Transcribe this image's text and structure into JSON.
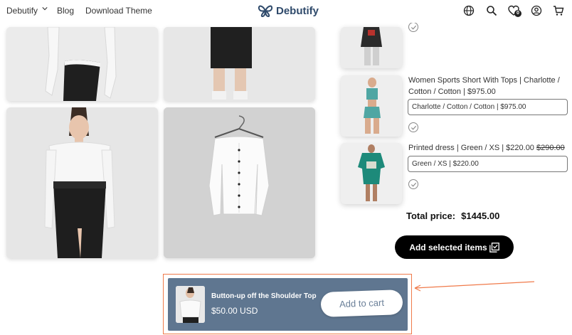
{
  "header": {
    "nav": [
      "Debutify",
      "Blog",
      "Download Theme"
    ],
    "logo_text": "Debutify",
    "wishlist_count": "0",
    "icons": [
      "globe-icon",
      "search-icon",
      "heart-icon",
      "account-icon",
      "cart-icon"
    ]
  },
  "bundle": {
    "products": [
      {
        "title": "Women Sports Short With Tops | Charlotte / Cotton / Cotton | $975.00",
        "variant": "Charlotte / Cotton / Cotton | $975.00"
      },
      {
        "title_main": "Printed dress | Green / XS | $220.00",
        "title_compare": "$290.00",
        "variant": "Green / XS | $220.00"
      }
    ],
    "total_label": "Total price:",
    "total_value": "$1445.00",
    "add_selected_label": "Add selected items"
  },
  "sticky_bar": {
    "title": "Button-up off the Shoulder Top",
    "price": "$50.00 USD",
    "button_label": "Add to cart"
  },
  "colors": {
    "sticky_bg": "#5f7690",
    "highlight": "#f07a4a",
    "logo": "#2f4a6b"
  }
}
